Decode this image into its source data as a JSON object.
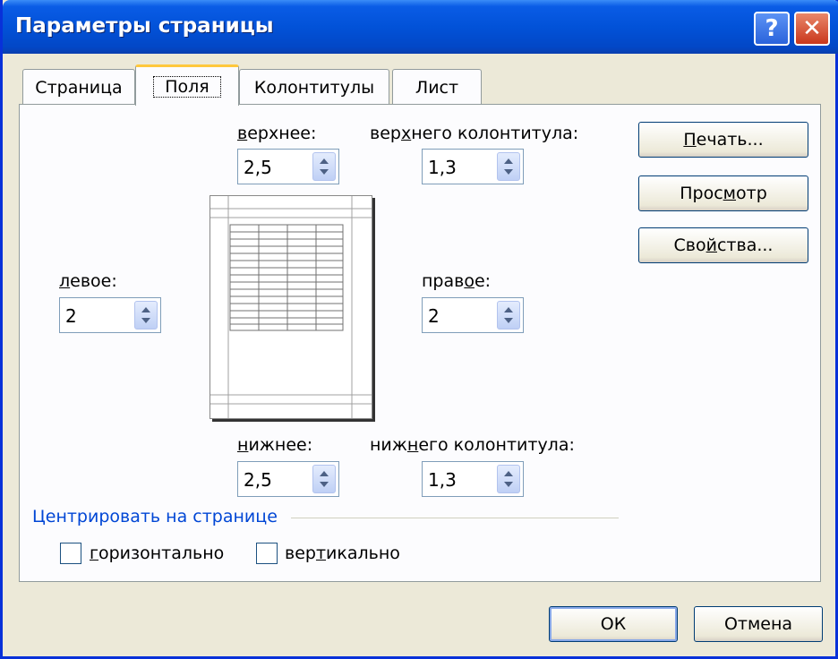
{
  "window": {
    "title": "Параметры страницы",
    "help_label": "?",
    "close_label": "✕"
  },
  "tabs": [
    {
      "label": "Страница",
      "active": false
    },
    {
      "label": "Поля",
      "active": true
    },
    {
      "label": "Колонтитулы",
      "active": false
    },
    {
      "label": "Лист",
      "active": false
    }
  ],
  "margins": {
    "top": {
      "label_underlined": "в",
      "label_rest": "ерхнее:",
      "value": "2,5"
    },
    "header": {
      "label_pre": "вер",
      "label_underlined": "х",
      "label_rest": "него колонтитула:",
      "value": "1,3"
    },
    "left": {
      "label_underlined": "л",
      "label_rest": "евое:",
      "value": "2"
    },
    "right": {
      "label_pre": "прав",
      "label_underlined": "о",
      "label_rest": "е:",
      "value": "2"
    },
    "bottom": {
      "label_underlined": "н",
      "label_rest": "ижнее:",
      "value": "2,5"
    },
    "footer": {
      "label_pre": "ниж",
      "label_underlined": "н",
      "label_rest": "его колонтитула:",
      "value": "1,3"
    }
  },
  "side_buttons": {
    "print": {
      "pre": "",
      "underlined": "П",
      "rest": "ечать..."
    },
    "preview": {
      "pre": "Прос",
      "underlined": "м",
      "rest": "отр"
    },
    "properties": {
      "pre": "Сво",
      "underlined": "й",
      "rest": "ства..."
    }
  },
  "center": {
    "group_label": "Центрировать на странице",
    "horizontal": {
      "underlined": "г",
      "rest": "оризонтально",
      "checked": false
    },
    "vertical": {
      "pre": "вер",
      "underlined": "т",
      "rest": "икально",
      "checked": false
    }
  },
  "footer_buttons": {
    "ok": "ОК",
    "cancel": "Отмена"
  },
  "colors": {
    "titlebar": "#0252d8",
    "face": "#ece9d8",
    "group_label": "#0046d5",
    "active_tab_accent": "#ffc83c"
  }
}
